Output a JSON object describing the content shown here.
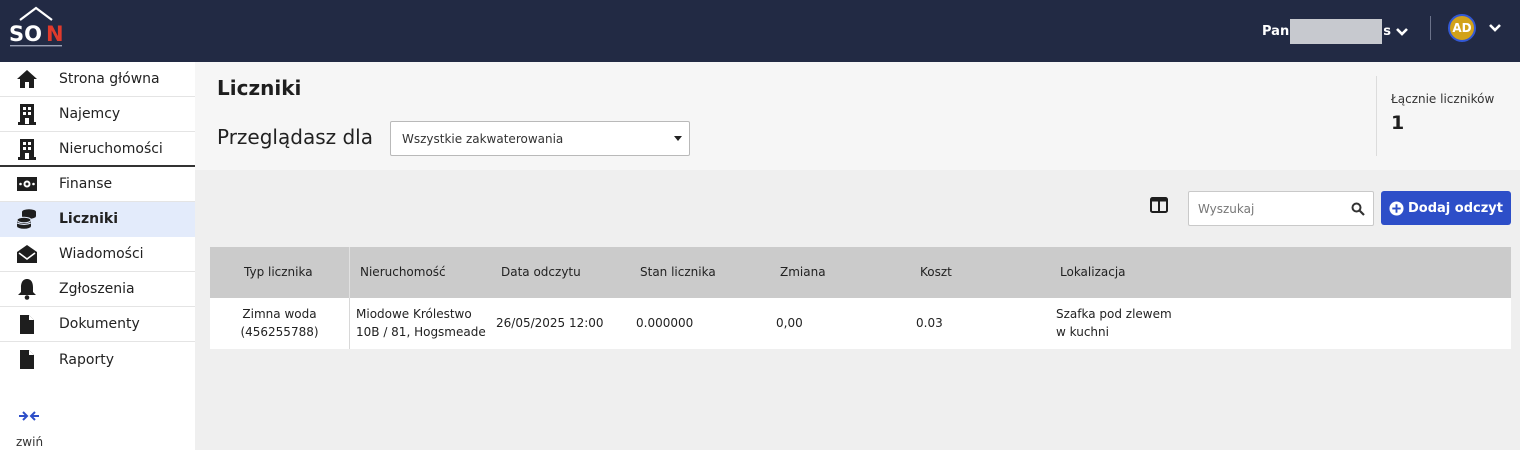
{
  "topbar": {
    "logo_text": "SON",
    "user_name_prefix": "Pan",
    "user_name_suffix": "s",
    "avatar_initials": "AD"
  },
  "sidebar": {
    "items": [
      {
        "label": "Strona główna",
        "icon": "home-icon"
      },
      {
        "label": "Najemcy",
        "icon": "building-icon"
      },
      {
        "label": "Nieruchomości",
        "icon": "building-icon"
      },
      {
        "label": "Finanse",
        "icon": "money-icon"
      },
      {
        "label": "Liczniki",
        "icon": "coins-icon"
      },
      {
        "label": "Wiadomości",
        "icon": "envelope-icon"
      },
      {
        "label": "Zgłoszenia",
        "icon": "bell-icon"
      },
      {
        "label": "Dokumenty",
        "icon": "file-icon"
      },
      {
        "label": "Raporty",
        "icon": "file-icon"
      }
    ],
    "active_item": "Liczniki",
    "collapse_label": "zwiń"
  },
  "header": {
    "title": "Liczniki",
    "browse_label": "Przeglądasz dla",
    "select_value": "Wszystkie zakwaterowania",
    "stat_label": "Łącznie liczników",
    "stat_value": "1"
  },
  "toolbar": {
    "search_placeholder": "Wyszukaj",
    "add_button_label": "Dodaj odczyt"
  },
  "table": {
    "columns": [
      "Typ licznika",
      "Nieruchomość",
      "Data odczytu",
      "Stan licznika",
      "Zmiana",
      "Koszt",
      "Lokalizacja"
    ],
    "rows": [
      {
        "type_line1": "Zimna woda",
        "type_line2": "(456255788)",
        "property_line1": "Miodowe Królestwo",
        "property_line2": "10B / 81, Hogsmeade",
        "date": "26/05/2025 12:00",
        "state": "0.000000",
        "change": "0,00",
        "cost": "0.03",
        "location_line1": "Szafka pod zlewem",
        "location_line2": "w kuchni"
      }
    ]
  },
  "colors": {
    "topbar_bg": "#222a44",
    "accent": "#2d4ec8",
    "active_item_bg": "#e3ebfb",
    "avatar_bg": "#d2a21a"
  }
}
